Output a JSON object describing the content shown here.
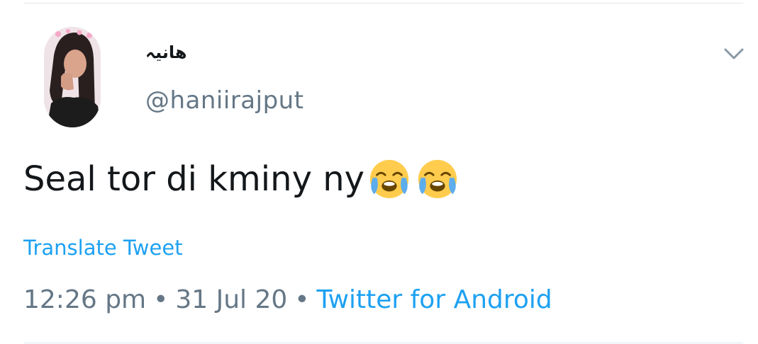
{
  "tweet": {
    "display_name": "هانیہ",
    "handle": "@haniirajput",
    "text": "Seal tor di kminy ny",
    "emojis": [
      "loudly-crying-face-icon",
      "loudly-crying-face-icon"
    ],
    "translate_label": "Translate Tweet",
    "time": "12:26 pm",
    "separator": "•",
    "date": "31 Jul 20",
    "source": "Twitter for Android"
  },
  "icons": {
    "menu": "chevron-down-icon"
  },
  "colors": {
    "text": "#14171a",
    "secondary": "#657786",
    "link": "#1da1f2",
    "divider": "#e1e8ed"
  }
}
